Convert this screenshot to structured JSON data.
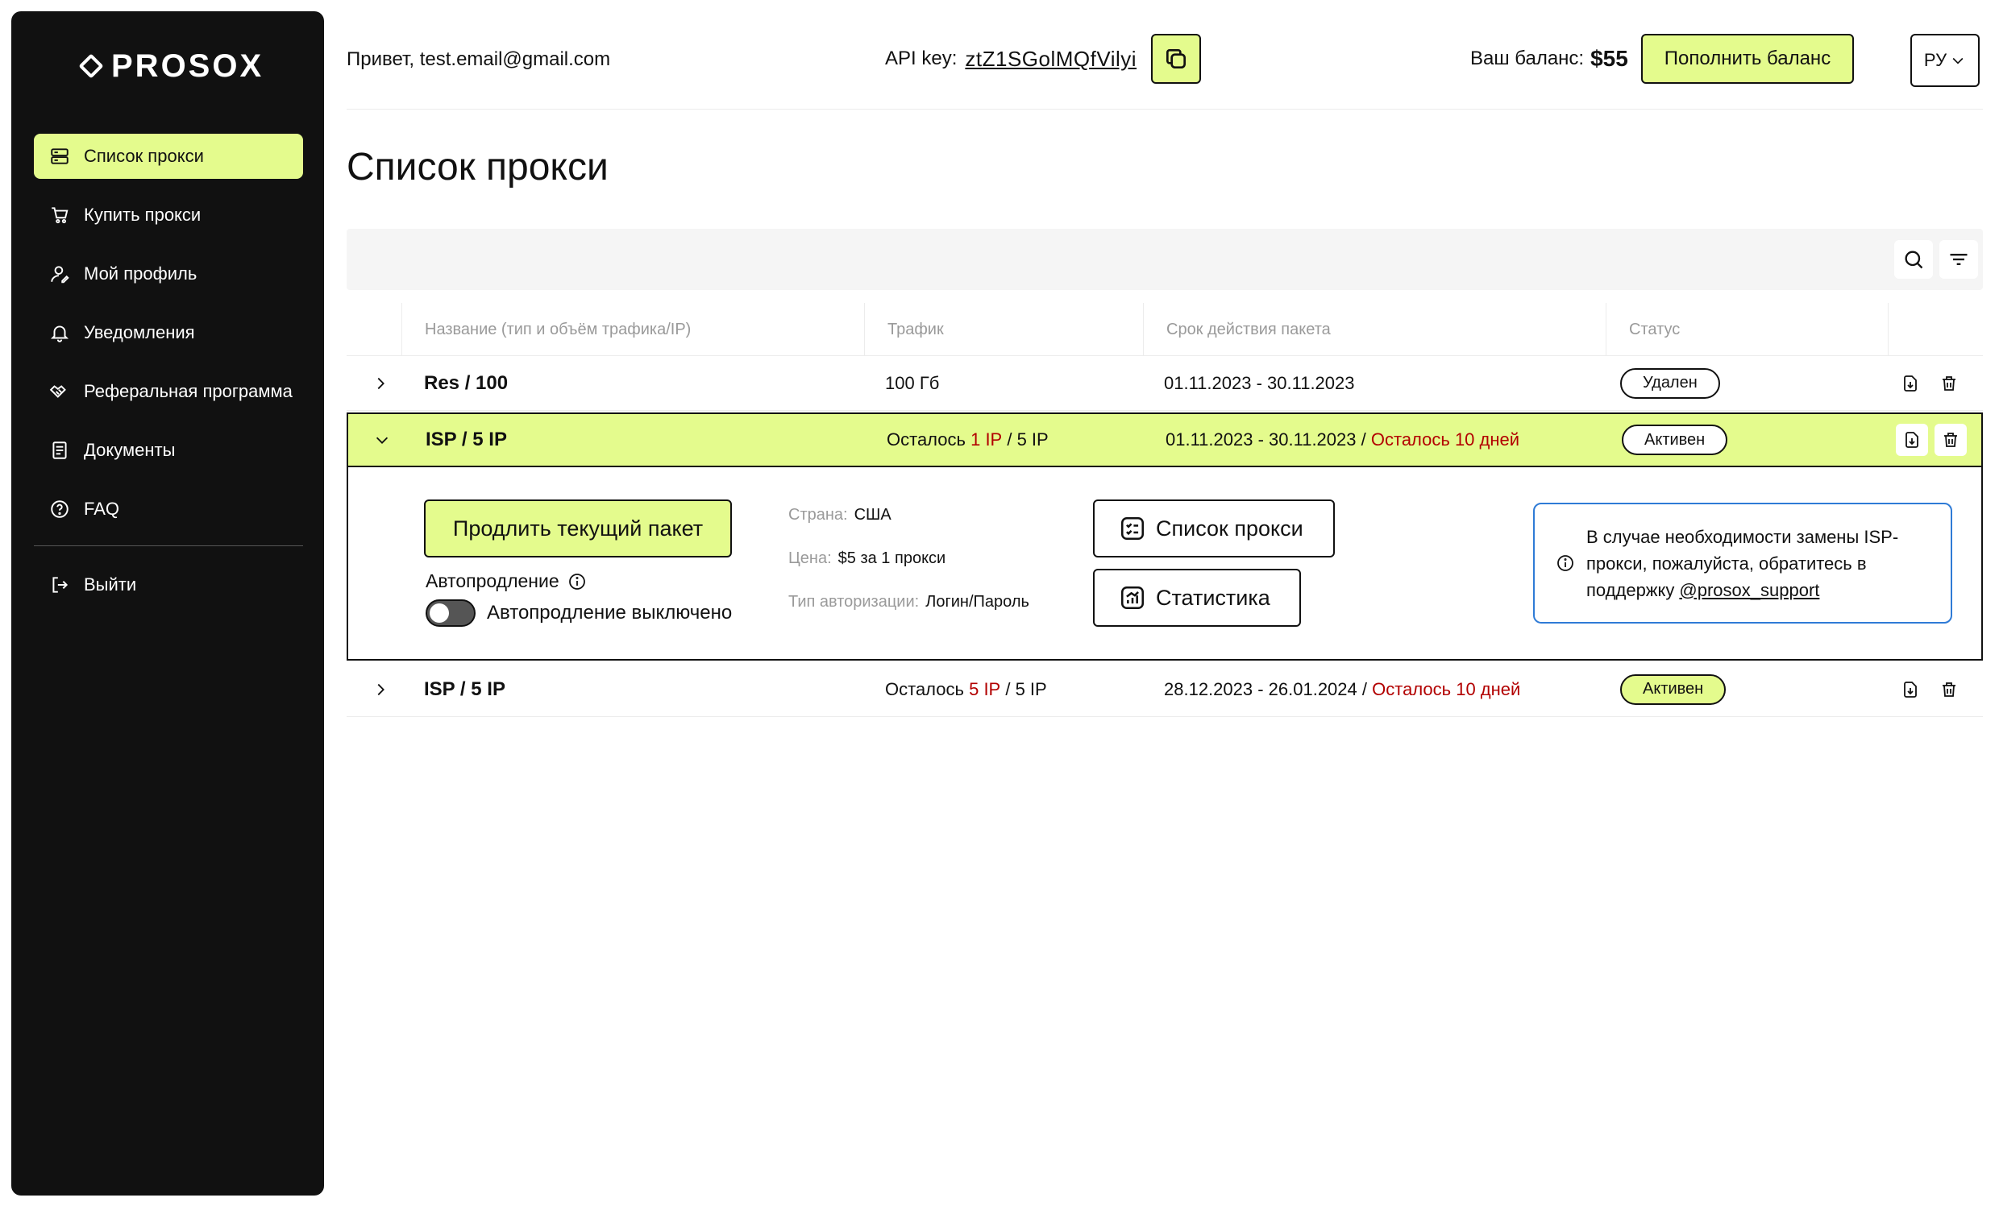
{
  "sidebar": {
    "logo": "PROSOX",
    "items": [
      {
        "label": "Список прокси"
      },
      {
        "label": "Купить прокси"
      },
      {
        "label": "Мой профиль"
      },
      {
        "label": "Уведомления"
      },
      {
        "label": "Реферальная программа"
      },
      {
        "label": "Документы"
      },
      {
        "label": "FAQ"
      }
    ],
    "logout": "Выйти"
  },
  "header": {
    "greeting": "Привет,",
    "email": "test.email@gmail.com",
    "api_label": "API key:",
    "api_key": "ztZ1SGolMQfVilyi",
    "balance_label": "Ваш баланс:",
    "balance_value": "$55",
    "topup_label": "Пополнить баланс",
    "lang": "РУ"
  },
  "page": {
    "title": "Список прокси"
  },
  "table": {
    "columns": [
      "Название (тип и объём трафика/IP)",
      "Трафик",
      "Срок действия пакета",
      "Статус"
    ],
    "rows": [
      {
        "name": "Res / 100",
        "traffic": "100 Гб",
        "period": "01.11.2023 - 30.11.2023",
        "status": "Удален"
      },
      {
        "name": "ISP / 5 IP",
        "traffic_prefix": "Осталось",
        "traffic_left": "1 IP",
        "traffic_total": "/ 5 IP",
        "period": "01.11.2023 - 30.11.2023",
        "period_sep": "/",
        "days_left": "Осталось 10 дней",
        "status": "Активен"
      },
      {
        "name": "ISP / 5 IP",
        "traffic_prefix": "Осталось",
        "traffic_left": "5 IP",
        "traffic_total": "/ 5 IP",
        "period": "28.12.2023 - 26.01.2024",
        "period_sep": "/",
        "days_left": "Осталось 10 дней",
        "status": "Активен"
      }
    ]
  },
  "details": {
    "renew_label": "Продлить текущий пакет",
    "autorenew_label": "Автопродление",
    "autorenew_state": "Автопродление выключено",
    "country_label": "Страна:",
    "country_value": "США",
    "price_label": "Цена:",
    "price_value": "$5 за 1 прокси",
    "auth_label": "Тип авторизации:",
    "auth_value": "Логин/Пароль",
    "proxy_list_button": "Список прокси",
    "stats_button": "Статистика",
    "notice_text": "В случае необходимости замены ISP-прокси, пожалуйста, обратитесь в поддержку",
    "notice_link": "@prosox_support"
  },
  "colors": {
    "accent": "#E4FB8D",
    "sidebar_bg": "#111111",
    "warning_red": "#B20000",
    "notice_border": "#2F7BD6"
  }
}
